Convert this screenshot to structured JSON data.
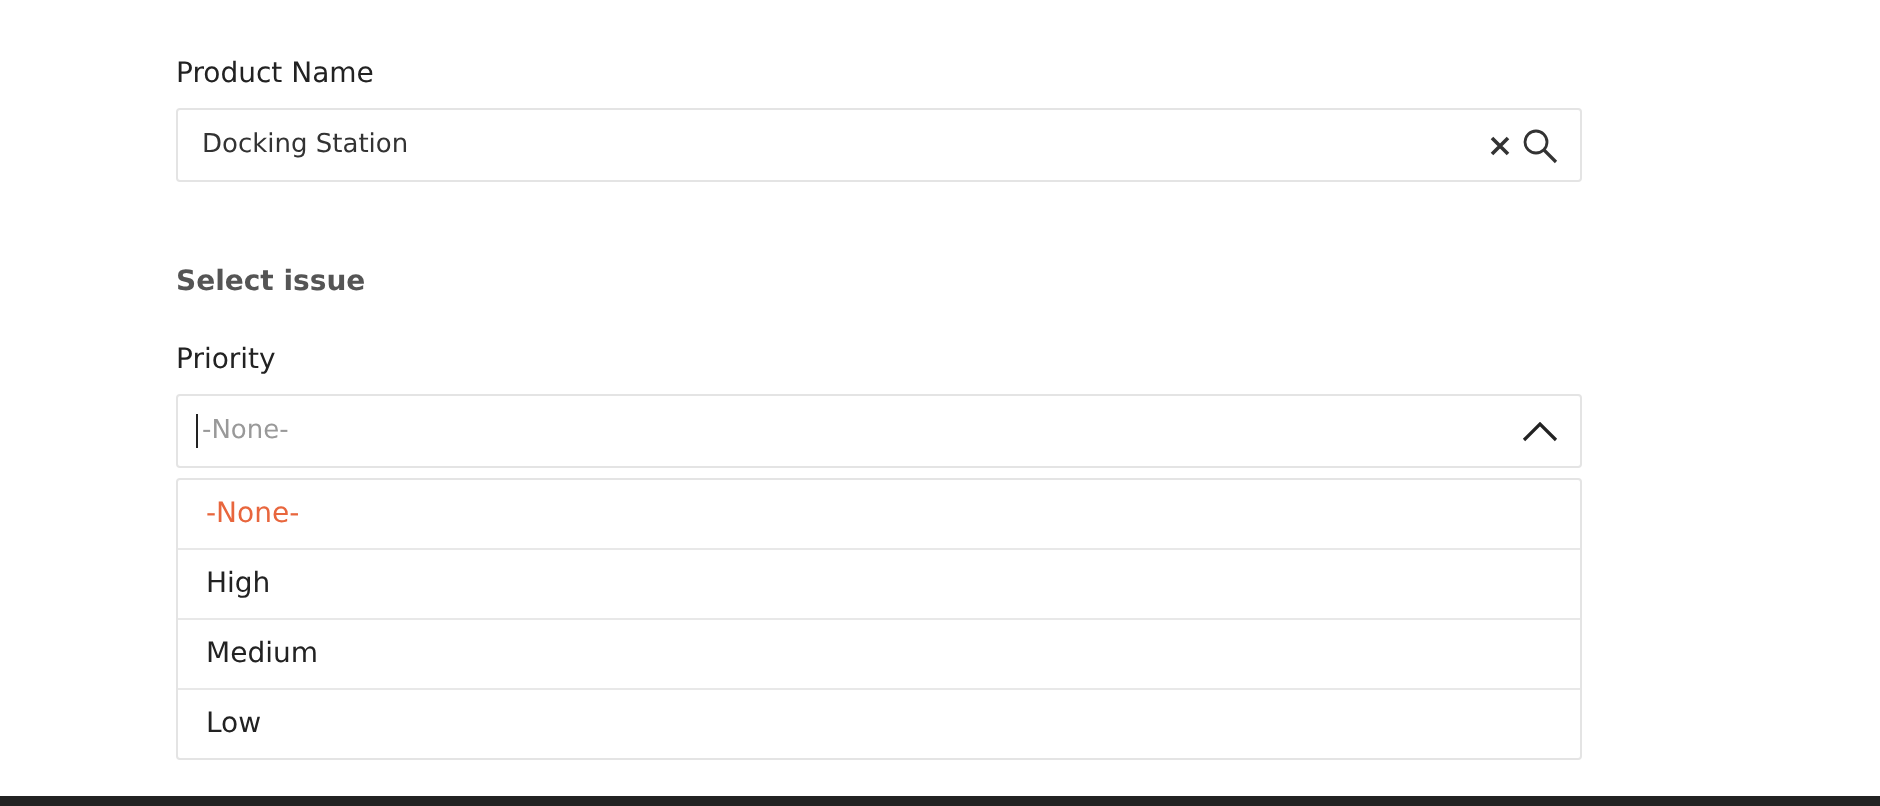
{
  "product_field": {
    "label": "Product Name",
    "value": "Docking Station"
  },
  "section": {
    "title": "Select issue"
  },
  "priority": {
    "label": "Priority",
    "placeholder": "-None-",
    "expanded": true,
    "options": [
      {
        "label": "-None-",
        "selected": true
      },
      {
        "label": "High",
        "selected": false
      },
      {
        "label": "Medium",
        "selected": false
      },
      {
        "label": "Low",
        "selected": false
      }
    ]
  }
}
